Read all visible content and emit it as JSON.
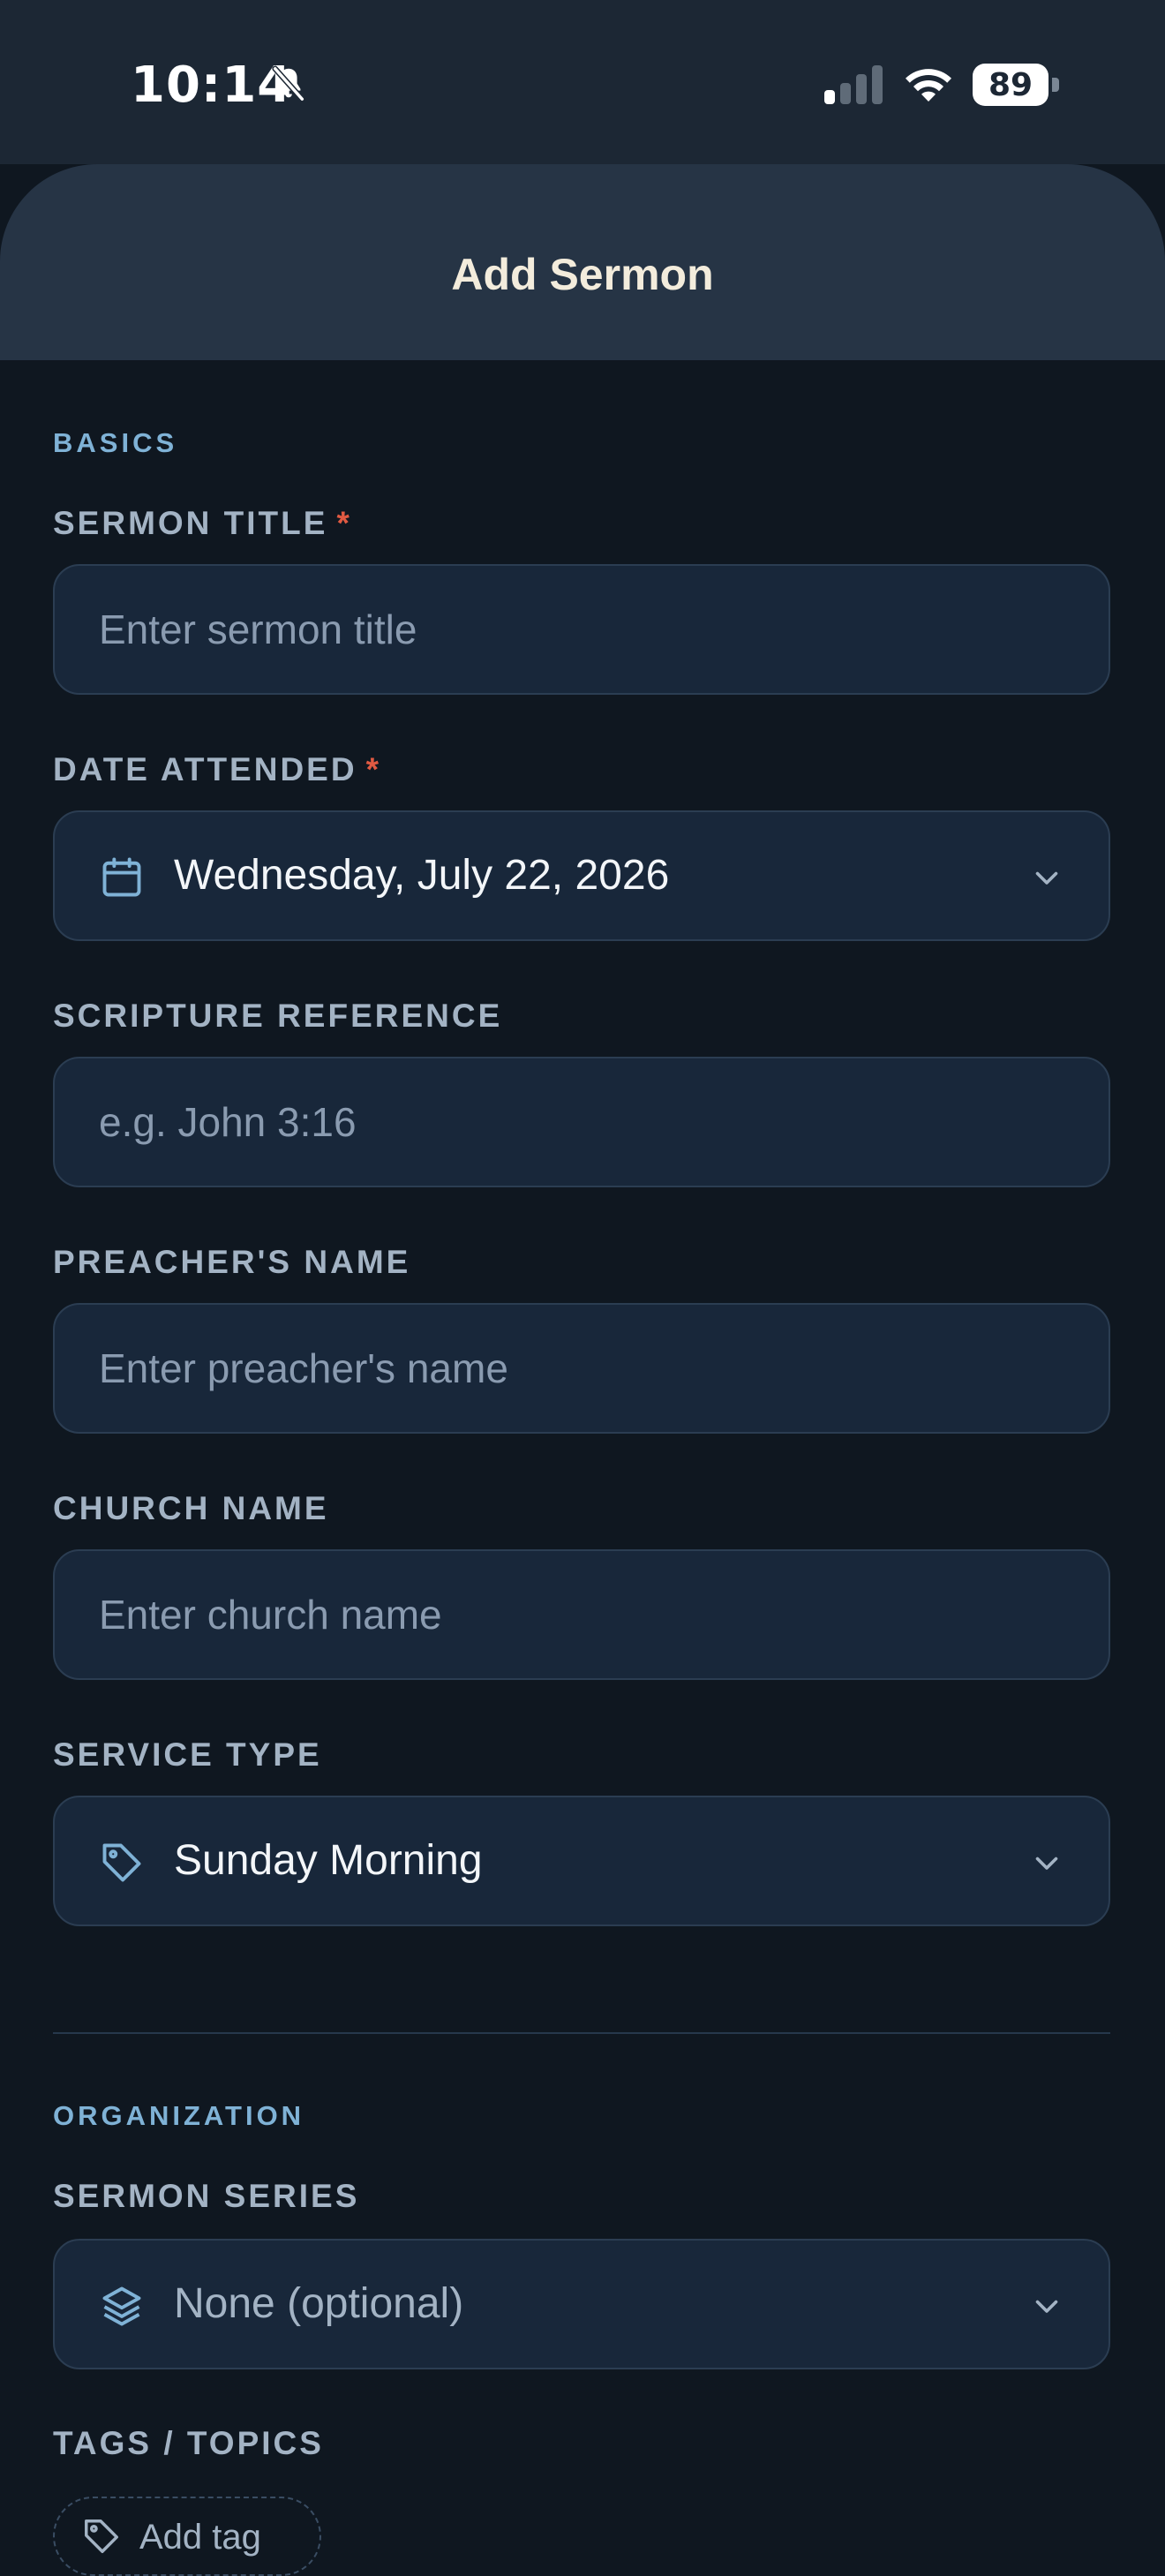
{
  "status_bar": {
    "time": "10:14",
    "battery": "89"
  },
  "header": {
    "title": "Add Sermon"
  },
  "sections": {
    "basics": "BASICS",
    "organization": "ORGANIZATION"
  },
  "fields": {
    "sermon_title": {
      "label": "SERMON TITLE",
      "required": "*",
      "placeholder": "Enter sermon title"
    },
    "date_attended": {
      "label": "DATE ATTENDED",
      "required": "*",
      "value": "Wednesday, July 22, 2026"
    },
    "scripture": {
      "label": "SCRIPTURE REFERENCE",
      "placeholder": "e.g. John 3:16"
    },
    "preacher": {
      "label": "PREACHER'S NAME",
      "placeholder": "Enter preacher's name"
    },
    "church": {
      "label": "CHURCH NAME",
      "placeholder": "Enter church name"
    },
    "service_type": {
      "label": "SERVICE TYPE",
      "value": "Sunday Morning"
    },
    "sermon_series": {
      "label": "SERMON SERIES",
      "value": "None (optional)"
    },
    "tags": {
      "label": "TAGS / TOPICS",
      "add_label": "Add tag"
    }
  },
  "colors": {
    "background": "#0f1720",
    "header": "#263445",
    "field_bg": "#18273a",
    "accent_label": "#7fb2d6",
    "required": "#e05a42",
    "title_text": "#f3ecdc"
  },
  "icons": {
    "calendar": "calendar-icon",
    "tag": "tag-icon",
    "layers": "layers-icon",
    "chevron": "chevron-down-icon"
  }
}
